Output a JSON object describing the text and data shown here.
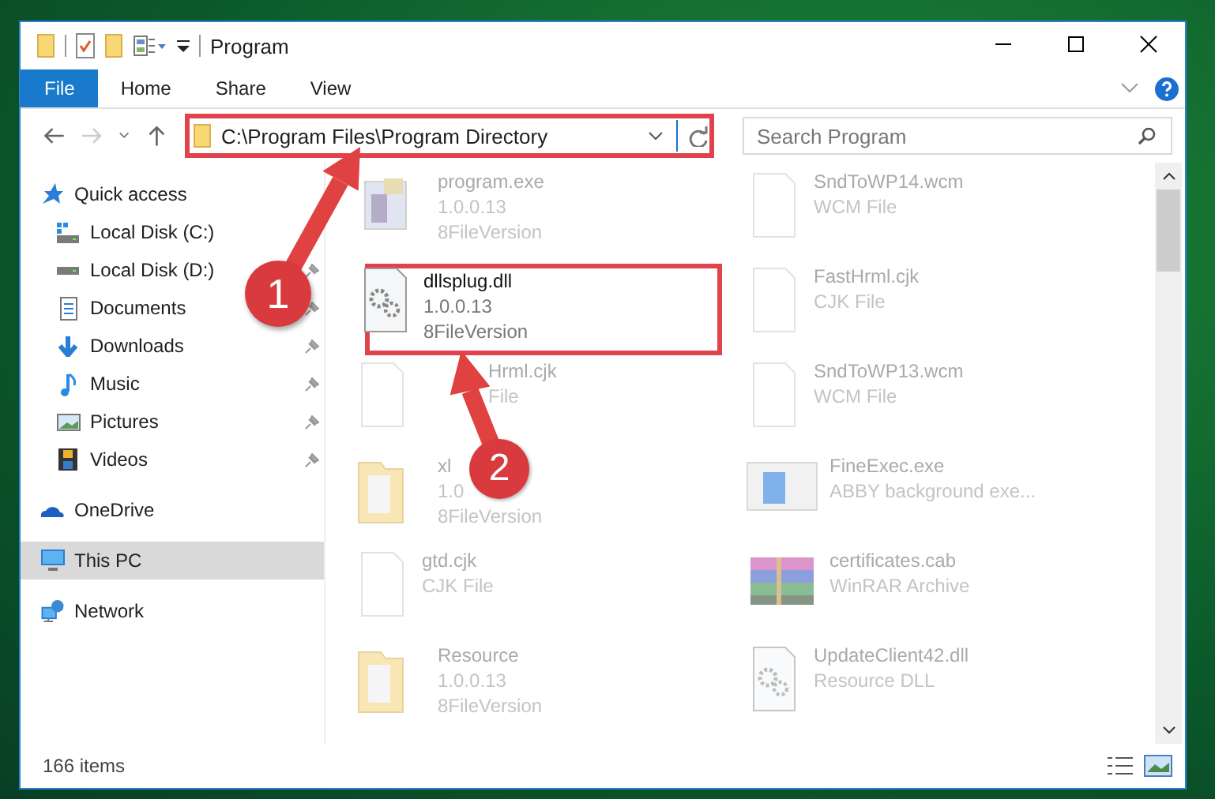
{
  "window": {
    "title": "Program"
  },
  "ribbon_tabs": [
    {
      "label": "File",
      "selected": true
    },
    {
      "label": "Home",
      "selected": false
    },
    {
      "label": "Share",
      "selected": false
    },
    {
      "label": "View",
      "selected": false
    }
  ],
  "address": {
    "value": "C:\\Program Files\\Program Directory",
    "highlighted": true
  },
  "search": {
    "placeholder": "Search Program"
  },
  "sidebar": {
    "items": [
      {
        "label": "Quick access",
        "kind": "root",
        "pinned": false,
        "selected": false
      },
      {
        "label": "Local Disk (C:)",
        "kind": "child",
        "pinned": false,
        "selected": false
      },
      {
        "label": "Local Disk (D:)",
        "kind": "child",
        "pinned": true,
        "selected": false
      },
      {
        "label": "Documents",
        "kind": "child",
        "pinned": true,
        "selected": false
      },
      {
        "label": "Downloads",
        "kind": "child",
        "pinned": true,
        "selected": false
      },
      {
        "label": "Music",
        "kind": "child",
        "pinned": true,
        "selected": false
      },
      {
        "label": "Pictures",
        "kind": "child",
        "pinned": true,
        "selected": false
      },
      {
        "label": "Videos",
        "kind": "child",
        "pinned": true,
        "selected": false
      },
      {
        "label": "OneDrive",
        "kind": "root",
        "pinned": false,
        "selected": false
      },
      {
        "label": "This PC",
        "kind": "root",
        "pinned": false,
        "selected": true
      },
      {
        "label": "Network",
        "kind": "root",
        "pinned": false,
        "selected": false
      }
    ]
  },
  "files": [
    {
      "kind": "app",
      "lines": [
        "program.exe",
        "1.0.0.13",
        "8FileVersion"
      ],
      "blurred": true,
      "highlighted": false
    },
    {
      "kind": "blank",
      "lines": [
        "SndToWP14.wcm",
        "WCM File"
      ],
      "blurred": true,
      "highlighted": false
    },
    {
      "kind": "gears",
      "lines": [
        "dllsplug.dll",
        "1.0.0.13",
        "8FileVersion"
      ],
      "blurred": false,
      "highlighted": true
    },
    {
      "kind": "blank",
      "lines": [
        "FastHrml.cjk",
        "CJK File"
      ],
      "blurred": true,
      "highlighted": false
    },
    {
      "kind": "blank-covered",
      "lines": [
        "Hrml.cjk",
        "File"
      ],
      "blurred": true,
      "highlighted": false
    },
    {
      "kind": "blank",
      "lines": [
        "SndToWP13.wcm",
        "WCM File"
      ],
      "blurred": true,
      "highlighted": false
    },
    {
      "kind": "folder",
      "lines": [
        "xl",
        "1.0",
        "8FileVersion"
      ],
      "blurred": true,
      "highlighted": false
    },
    {
      "kind": "window",
      "lines": [
        "FineExec.exe",
        "ABBY background exe..."
      ],
      "blurred": true,
      "highlighted": false
    },
    {
      "kind": "blank",
      "lines": [
        "gtd.cjk",
        "CJK File"
      ],
      "blurred": true,
      "highlighted": false
    },
    {
      "kind": "archive",
      "lines": [
        "certificates.cab",
        "WinRAR Archive"
      ],
      "blurred": true,
      "highlighted": false
    },
    {
      "kind": "folder",
      "lines": [
        "Resource",
        "1.0.0.13",
        "8FileVersion"
      ],
      "blurred": true,
      "highlighted": false
    },
    {
      "kind": "gears",
      "lines": [
        "UpdateClient42.dll",
        "Resource DLL"
      ],
      "blurred": true,
      "highlighted": false
    }
  ],
  "status_bar": {
    "count": "166 items"
  },
  "annotations": [
    {
      "number": "1"
    },
    {
      "number": "2"
    }
  ]
}
